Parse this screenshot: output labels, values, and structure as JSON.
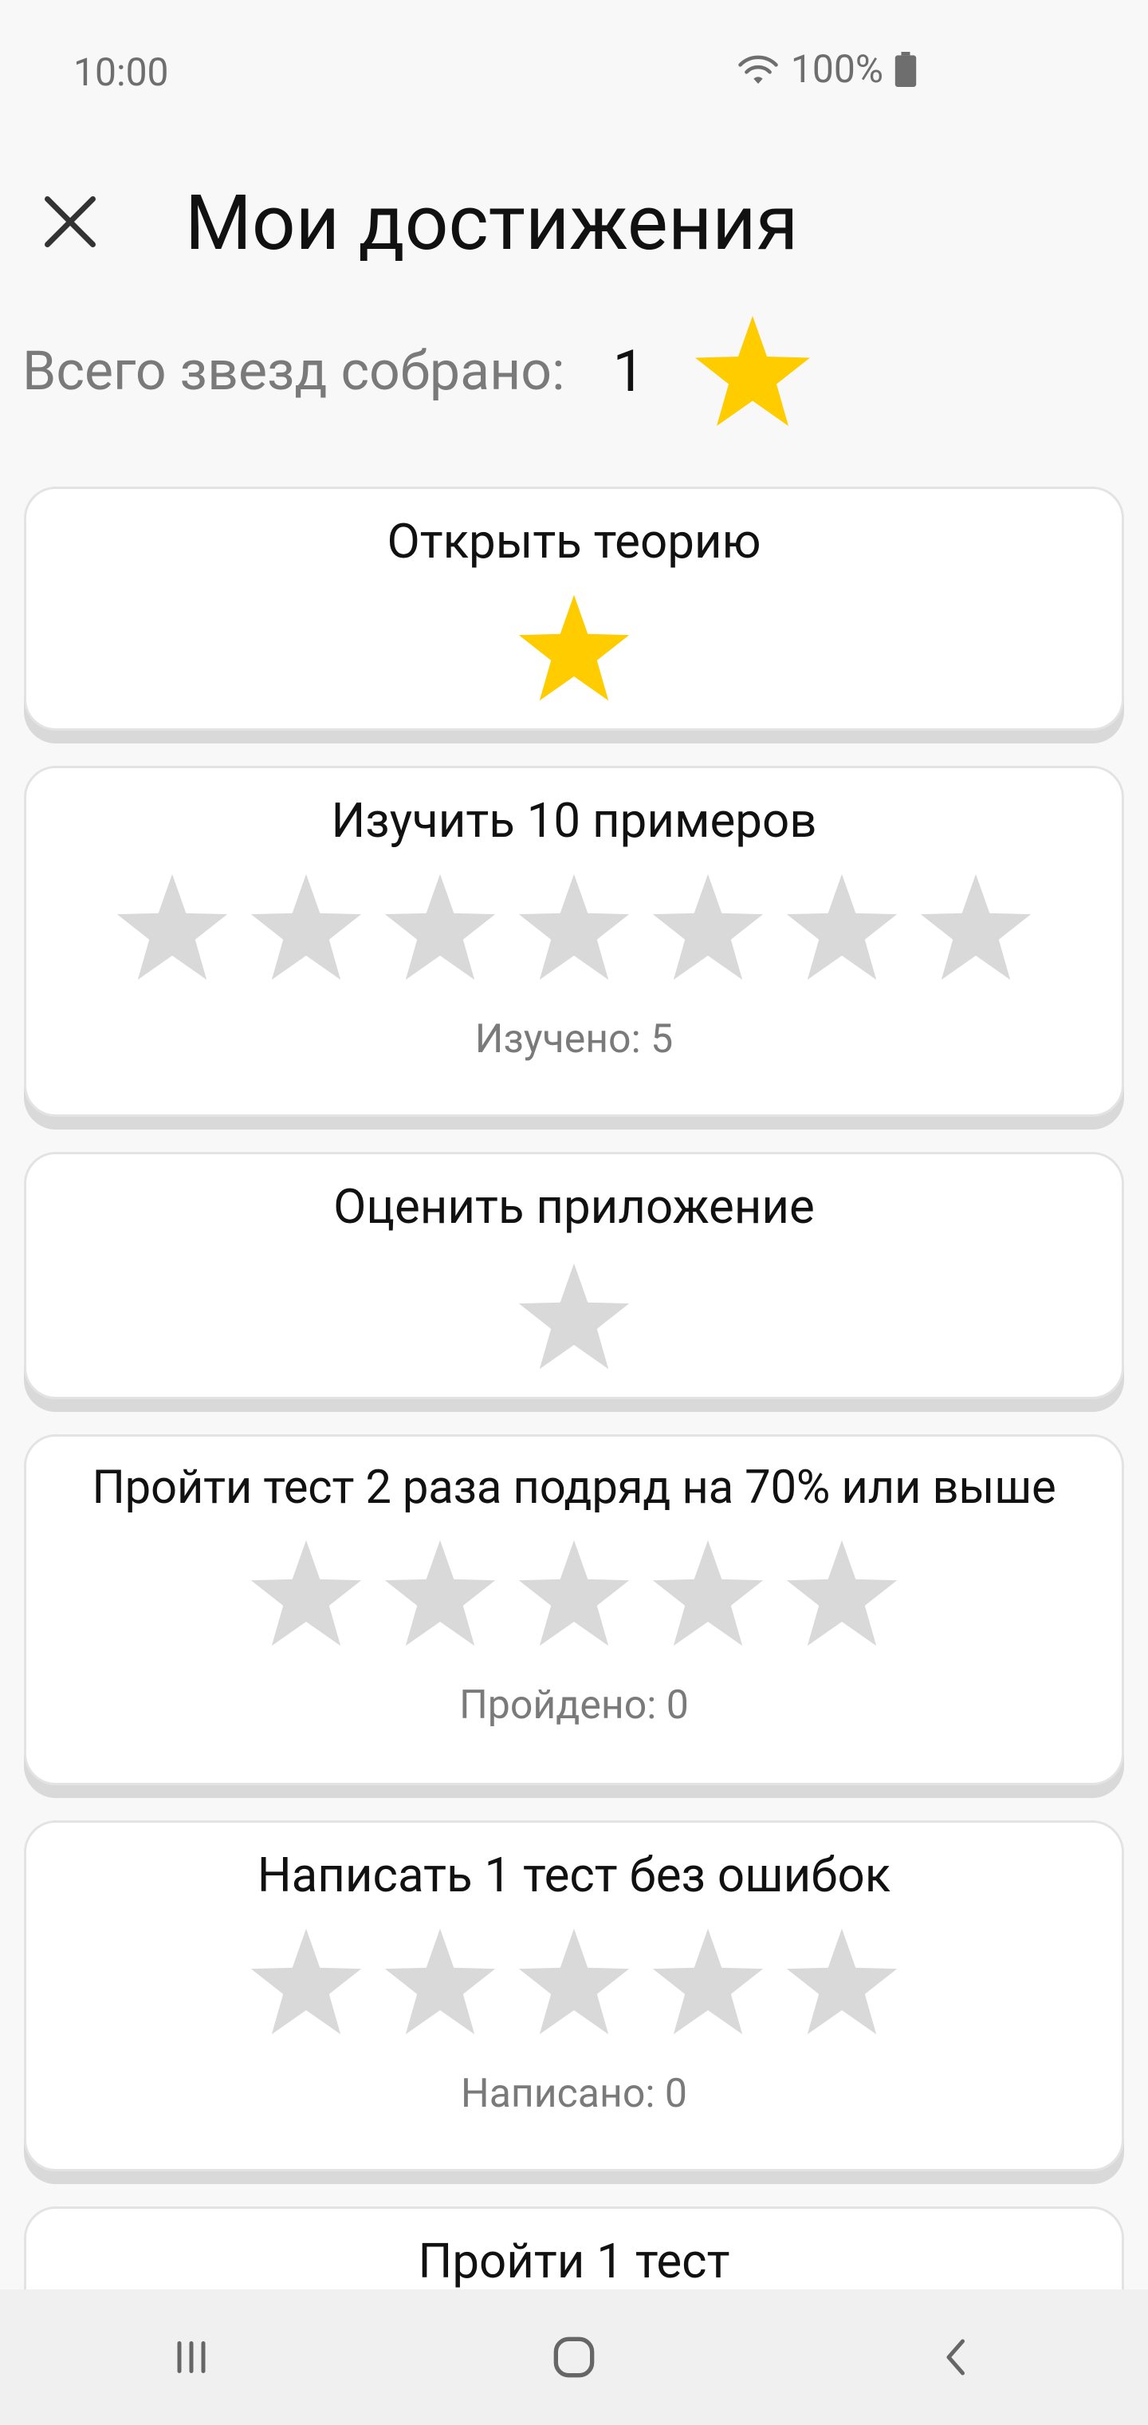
{
  "status_bar": {
    "time": "10:00",
    "battery": "100%",
    "wifi_icon": "wifi-icon",
    "battery_icon": "battery-icon"
  },
  "header": {
    "title": "Мои достижения",
    "close_icon": "close-icon"
  },
  "summary": {
    "label": "Всего звезд собрано:",
    "count": "1",
    "star_icon": "star-icon"
  },
  "colors": {
    "star_filled": "#FFCC00",
    "star_empty": "#D9D9D9",
    "background": "#F8F8F8",
    "card": "#FFFFFF"
  },
  "achievements": [
    {
      "title": "Открыть теорию",
      "stars_total": 1,
      "stars_earned": 1,
      "progress": ""
    },
    {
      "title": "Изучить 10 примеров",
      "stars_total": 7,
      "stars_earned": 0,
      "progress": "Изучено: 5"
    },
    {
      "title": "Оценить приложение",
      "stars_total": 1,
      "stars_earned": 0,
      "progress": ""
    },
    {
      "title": "Пройти тест 2 раза подряд на 70% или выше",
      "stars_total": 5,
      "stars_earned": 0,
      "progress": "Пройдено: 0"
    },
    {
      "title": "Написать 1 тест без ошибок",
      "stars_total": 5,
      "stars_earned": 0,
      "progress": "Написано: 0"
    },
    {
      "title": "Пройти 1 тест",
      "stars_total": 0,
      "stars_earned": 0,
      "progress": ""
    }
  ],
  "nav_bar": {
    "recents_icon": "recents-icon",
    "home_icon": "home-icon",
    "back_icon": "back-icon"
  }
}
